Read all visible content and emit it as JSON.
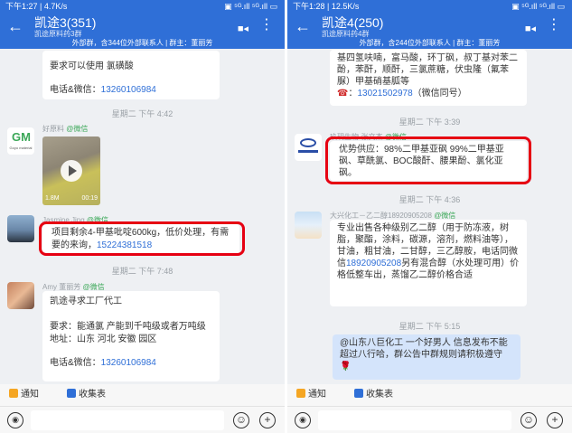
{
  "left": {
    "status": {
      "time": "下午1:27 | 4.7K/s",
      "indicators": "▣ ⁵ᴳ.ıll ⁵ᴳ.ıll ▭"
    },
    "title": "凯途3(351)",
    "subtitle": "凯途原料药3群",
    "notice": "外部群，含344位外部联系人 | 群主：董丽芳",
    "msg_top": {
      "line1": "要求可以使用 氯磺酸",
      "contact_label": "电话&微信：",
      "phone": "13260106984"
    },
    "time1": "星期二 下午 4:42",
    "video_sender": {
      "name": "好原料",
      "tag": "@微信",
      "size": "1.8M",
      "duration": "00:19",
      "logo_text": "Goyo material"
    },
    "jasmine": {
      "name": "Jasmine Jing",
      "tag": "@微信",
      "text": "项目剩余4-甲基吡啶600kg，低价处理，有需要的来询，",
      "phone": "15224381518"
    },
    "time2": "星期二 下午 7:48",
    "amy": {
      "name": "Amy 董丽芳",
      "tag": "@微信",
      "line1": "凯途寻求工厂代工",
      "line2": "要求：能通氯 产能到千吨级或者万吨级",
      "line3": "地址：山东 河北 安徽 园区",
      "contact_label": "电话&微信：",
      "phone": "13260106984"
    },
    "tabs": {
      "notice": "通知",
      "fav": "收集表"
    }
  },
  "right": {
    "status": {
      "time": "下午1:28 | 12.5K/s",
      "indicators": "▣ ⁵ᴳ.ıll ⁵ᴳ.ıll ▭"
    },
    "title": "凯途4(250)",
    "subtitle": "凯途原料药4群",
    "notice": "外部群，含244位外部联系人 | 群主：董丽芳",
    "msg_top": {
      "text": "基四氢呋喃，富马酸，环丁砜，叔丁基对苯二酚，苯酐，顺酐，三氯蔗糖，伏虫隆（氟苯脲）甲基硝基胍等",
      "phone_label": "：",
      "phone": "13021502978",
      "phone_suffix": "（微信同号）"
    },
    "time1": "星期二 下午 3:39",
    "sender1": {
      "name": "玖玥生物-张文杰",
      "tag": "@微信",
      "text": "优势供应：98%二甲基亚砜 99%二甲基亚砜、草酰氯、BOC酸酐、腰果酚、氯化亚砜。"
    },
    "time2": "星期二 下午 4:36",
    "sender2": {
      "name": "大兴化工－乙二醇18920905208",
      "tag": "@微信",
      "text1": "专业出售各种级别乙二醇（用于防冻液，树脂，聚酯，涂料，碳源，溶剂，燃料油等），甘油，粗甘油，二甘醇，三乙醇胺，电话同微信",
      "phone": "18920905208",
      "text2": "另有混合醇（水处理可用）价格低整车出，蒸馏乙二醇价格合适"
    },
    "time3": "星期二 下午 5:15",
    "self_msg": "@山东八巨化工 一个好男人 信息发布不能超过八行哈，群公告中群规则请积极遵守🌹",
    "tabs": {
      "notice": "通知",
      "fav": "收集表"
    }
  },
  "colors": {
    "header": "#2f6fd7",
    "highlight": "#e60012",
    "link": "#2f6fd7"
  }
}
